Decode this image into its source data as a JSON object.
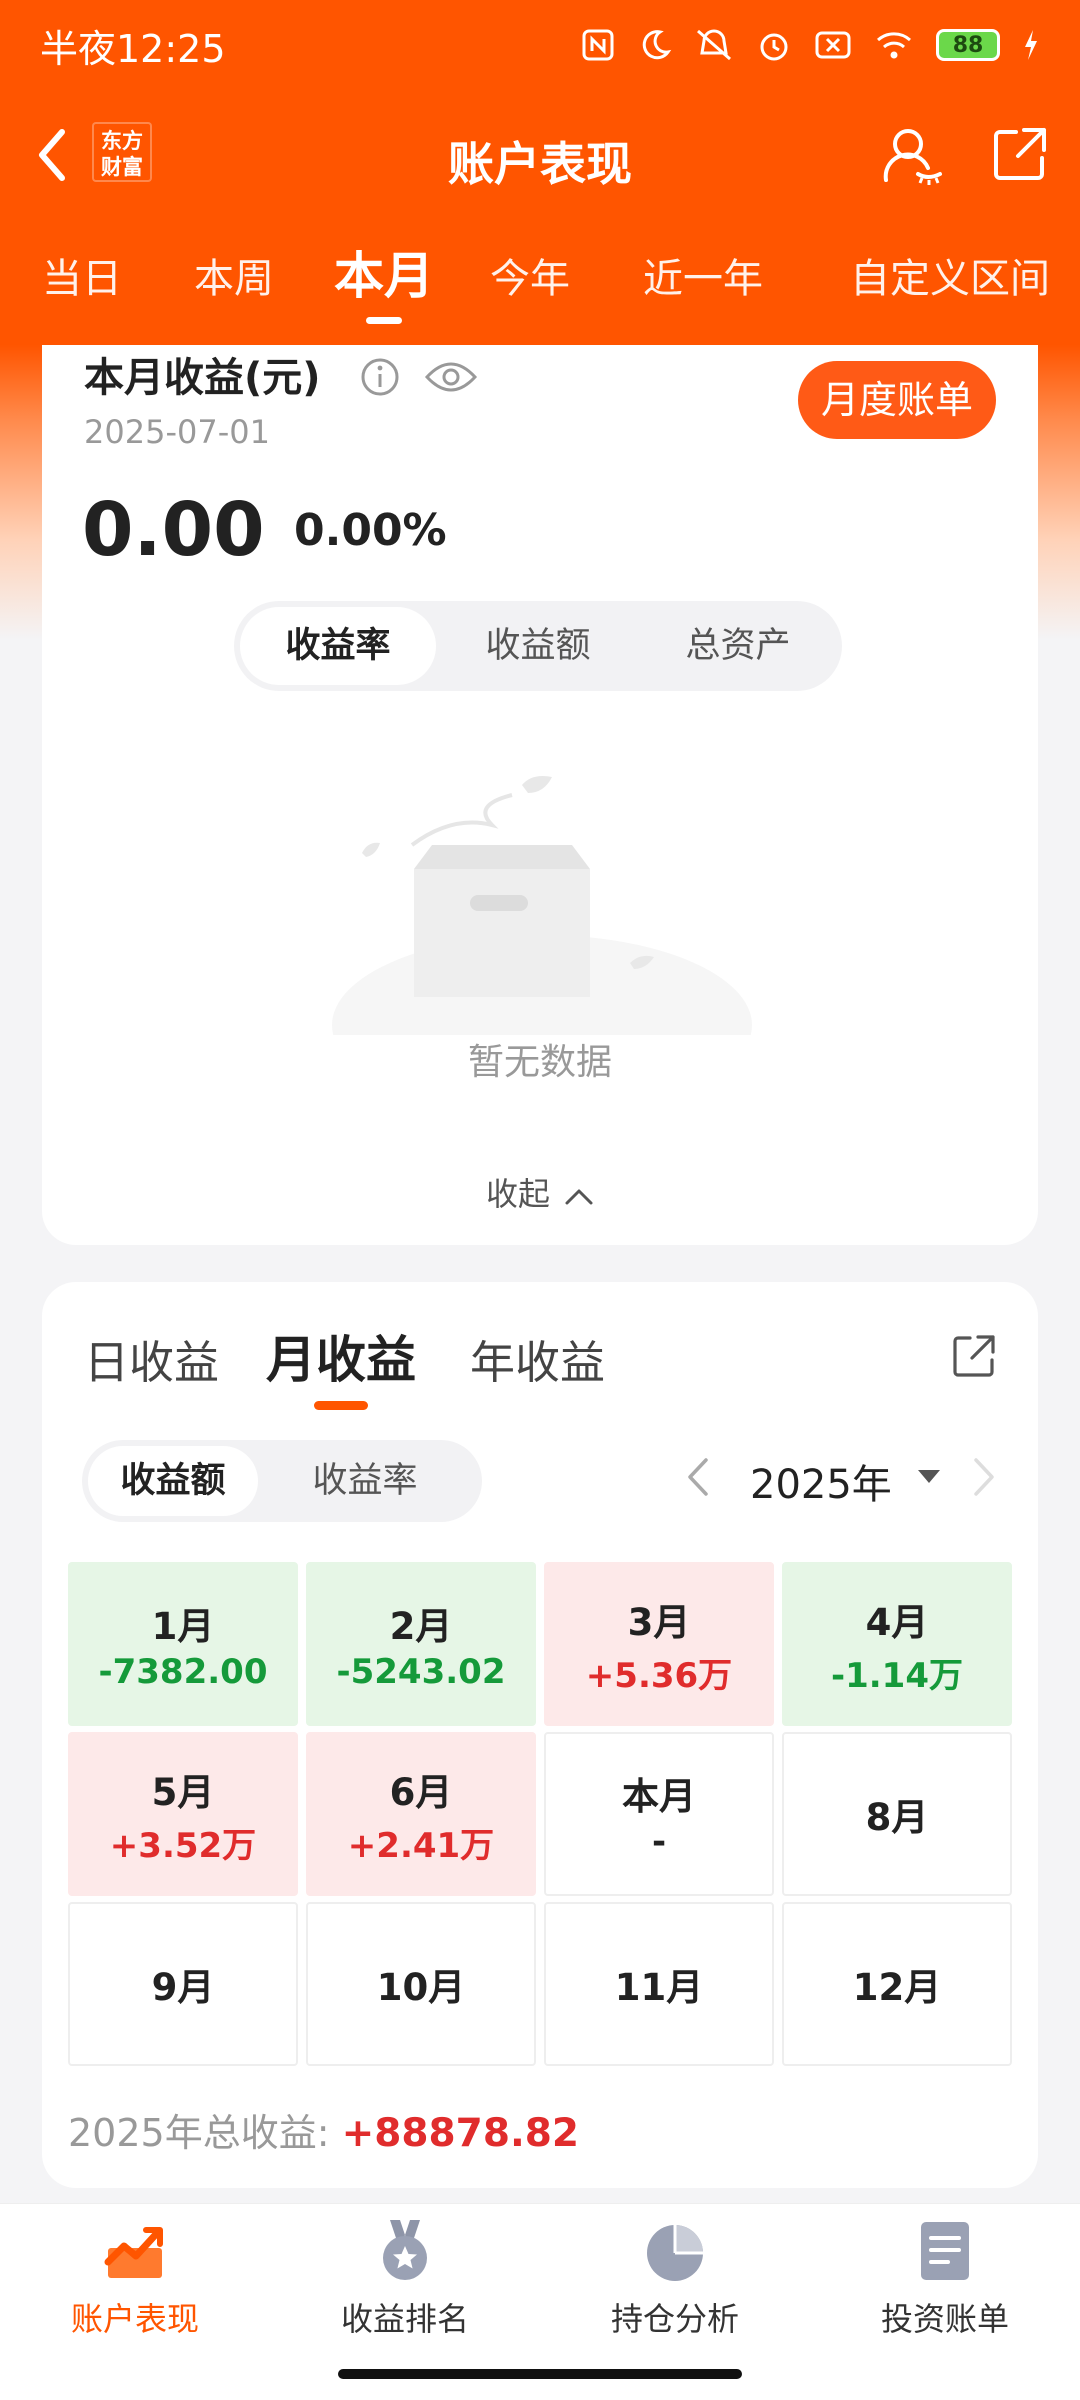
{
  "status_bar": {
    "time": "半夜12:25",
    "battery": "88"
  },
  "header": {
    "title": "账户表现",
    "logo_lines": [
      "东方",
      "财富"
    ]
  },
  "period_tabs": [
    "当日",
    "本周",
    "本月",
    "今年",
    "近一年",
    "自定义区间"
  ],
  "summary": {
    "title": "本月收益(元)",
    "date": "2025-07-01",
    "bill_button": "月度账单",
    "amount": "0.00",
    "rate": "0.00%",
    "metric_tabs": [
      "收益率",
      "收益额",
      "总资产"
    ],
    "empty_text": "暂无数据",
    "collapse_label": "收起"
  },
  "returns": {
    "tabs": [
      "日收益",
      "月收益",
      "年收益"
    ],
    "toggle": [
      "收益额",
      "收益率"
    ],
    "year": "2025年",
    "months": [
      {
        "name": "1月",
        "value": "-7382.00",
        "state": "loss"
      },
      {
        "name": "2月",
        "value": "-5243.02",
        "state": "loss"
      },
      {
        "name": "3月",
        "value": "+5.36万",
        "state": "gain"
      },
      {
        "name": "4月",
        "value": "-1.14万",
        "state": "loss"
      },
      {
        "name": "5月",
        "value": "+3.52万",
        "state": "gain"
      },
      {
        "name": "6月",
        "value": "+2.41万",
        "state": "gain"
      },
      {
        "name": "本月",
        "value": "-",
        "state": "current"
      },
      {
        "name": "8月",
        "value": "",
        "state": "empty"
      },
      {
        "name": "9月",
        "value": "",
        "state": "empty"
      },
      {
        "name": "10月",
        "value": "",
        "state": "empty"
      },
      {
        "name": "11月",
        "value": "",
        "state": "empty"
      },
      {
        "name": "12月",
        "value": "",
        "state": "empty"
      }
    ],
    "total_label": "2025年总收益: ",
    "total_value": "+88878.82"
  },
  "bottom_nav": [
    "账户表现",
    "收益排名",
    "持仓分析",
    "投资账单"
  ],
  "colors": {
    "brand": "#ff5500",
    "gain": "#e02c2c",
    "loss": "#159a3a",
    "gain_bg": "#fde9e9",
    "loss_bg": "#e6f6e6"
  },
  "icons": [
    "back-icon",
    "user-icon",
    "share-icon",
    "info-icon",
    "eye-icon",
    "export-icon",
    "chevron-up-icon",
    "chevron-left-icon",
    "chevron-right-icon",
    "dropdown-icon",
    "trend-chart-icon",
    "medal-icon",
    "pie-chart-icon",
    "document-icon"
  ]
}
